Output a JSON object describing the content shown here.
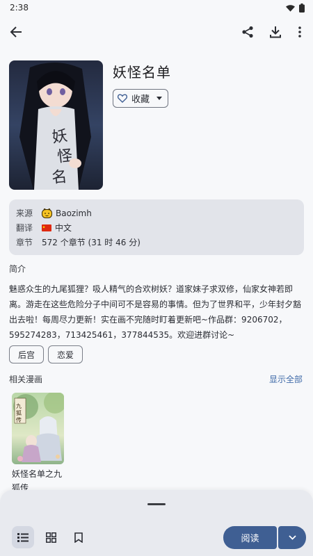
{
  "status_bar": {
    "time": "2:38",
    "icons": [
      "wifi-icon",
      "battery-icon"
    ]
  },
  "top_bar": {
    "icons": [
      "back-arrow-icon",
      "share-icon",
      "download-icon",
      "more-vert-icon"
    ]
  },
  "manga": {
    "title": "妖怪名单",
    "favorite_label": "收藏"
  },
  "info": {
    "source_label": "来源",
    "source_value": "Baozimh",
    "translation_label": "翻译",
    "translation_value": "中文",
    "chapters_label": "章节",
    "chapters_value": "572 个章节 (31 时 46 分)"
  },
  "synopsis": {
    "label": "简介",
    "text": "魅惑众生的九尾狐狸？吸人精气的合欢树妖？道家妹子求双修，仙家女神若即离。游走在这些危险分子中间可不是容易的事情。但为了世界和平，少年封夕豁出去啦！每周尽力更新！实在画不完随时盯着更新吧~作品群：9206702，595274283，713425461，377844535。欢迎进群讨论~"
  },
  "tags": [
    "后宫",
    "恋爱"
  ],
  "related": {
    "label": "相关漫画",
    "show_all": "显示全部",
    "items": [
      {
        "title": "妖怪名单之九狐传"
      }
    ]
  },
  "bottom_bar": {
    "read_label": "阅读"
  },
  "colors": {
    "accent": "#3f5f93",
    "link": "#3f6aa8",
    "card": "#e2e4ea"
  }
}
